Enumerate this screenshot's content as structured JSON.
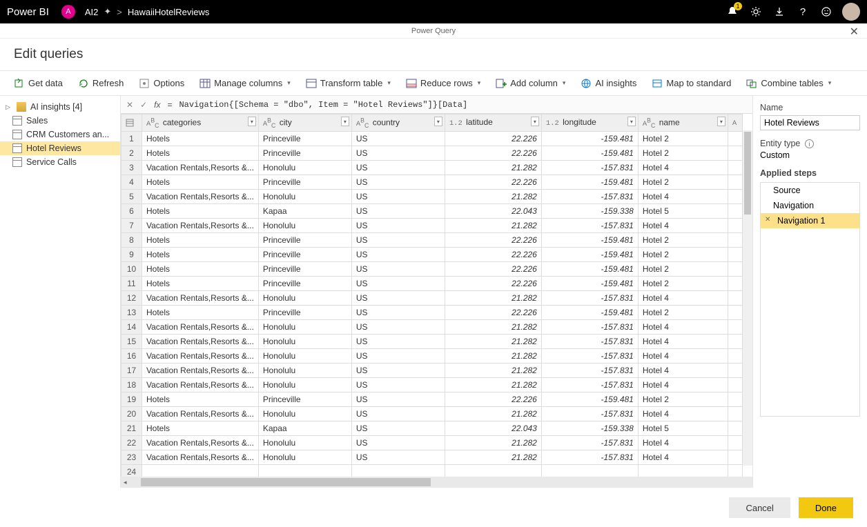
{
  "topbar": {
    "product": "Power BI",
    "pill": "A",
    "workspace": "AI2",
    "breadcrumb_sep": ">",
    "file": "HawaiiHotelReviews",
    "notification_badge": "1"
  },
  "pq": {
    "title": "Power Query",
    "heading": "Edit queries"
  },
  "ribbon": {
    "get_data": "Get data",
    "refresh": "Refresh",
    "options": "Options",
    "manage_columns": "Manage columns",
    "transform_table": "Transform table",
    "reduce_rows": "Reduce rows",
    "add_column": "Add column",
    "ai_insights": "AI insights",
    "map_to_standard": "Map to standard",
    "combine_tables": "Combine tables"
  },
  "nav": {
    "group_label": "AI insights [4]",
    "items": [
      "Sales",
      "CRM Customers an...",
      "Hotel Reviews",
      "Service Calls"
    ],
    "selected": "Hotel Reviews"
  },
  "formula": {
    "fx": "fx",
    "eq": "=",
    "expression": "Navigation{[Schema = \"dbo\", Item = \"Hotel Reviews\"]}[Data]"
  },
  "grid": {
    "columns": [
      {
        "type": "ABC",
        "name": "categories"
      },
      {
        "type": "ABC",
        "name": "city"
      },
      {
        "type": "ABC",
        "name": "country"
      },
      {
        "type": "1.2",
        "name": "latitude"
      },
      {
        "type": "1.2",
        "name": "longitude"
      },
      {
        "type": "ABC",
        "name": "name"
      }
    ],
    "rows": [
      {
        "n": 1,
        "categories": "Hotels",
        "city": "Princeville",
        "country": "US",
        "latitude": "22.226",
        "longitude": "-159.481",
        "name": "Hotel 2"
      },
      {
        "n": 2,
        "categories": "Hotels",
        "city": "Princeville",
        "country": "US",
        "latitude": "22.226",
        "longitude": "-159.481",
        "name": "Hotel 2"
      },
      {
        "n": 3,
        "categories": "Vacation Rentals,Resorts &...",
        "city": "Honolulu",
        "country": "US",
        "latitude": "21.282",
        "longitude": "-157.831",
        "name": "Hotel 4"
      },
      {
        "n": 4,
        "categories": "Hotels",
        "city": "Princeville",
        "country": "US",
        "latitude": "22.226",
        "longitude": "-159.481",
        "name": "Hotel 2"
      },
      {
        "n": 5,
        "categories": "Vacation Rentals,Resorts &...",
        "city": "Honolulu",
        "country": "US",
        "latitude": "21.282",
        "longitude": "-157.831",
        "name": "Hotel 4"
      },
      {
        "n": 6,
        "categories": "Hotels",
        "city": "Kapaa",
        "country": "US",
        "latitude": "22.043",
        "longitude": "-159.338",
        "name": "Hotel 5"
      },
      {
        "n": 7,
        "categories": "Vacation Rentals,Resorts &...",
        "city": "Honolulu",
        "country": "US",
        "latitude": "21.282",
        "longitude": "-157.831",
        "name": "Hotel 4"
      },
      {
        "n": 8,
        "categories": "Hotels",
        "city": "Princeville",
        "country": "US",
        "latitude": "22.226",
        "longitude": "-159.481",
        "name": "Hotel 2"
      },
      {
        "n": 9,
        "categories": "Hotels",
        "city": "Princeville",
        "country": "US",
        "latitude": "22.226",
        "longitude": "-159.481",
        "name": "Hotel 2"
      },
      {
        "n": 10,
        "categories": "Hotels",
        "city": "Princeville",
        "country": "US",
        "latitude": "22.226",
        "longitude": "-159.481",
        "name": "Hotel 2"
      },
      {
        "n": 11,
        "categories": "Hotels",
        "city": "Princeville",
        "country": "US",
        "latitude": "22.226",
        "longitude": "-159.481",
        "name": "Hotel 2"
      },
      {
        "n": 12,
        "categories": "Vacation Rentals,Resorts &...",
        "city": "Honolulu",
        "country": "US",
        "latitude": "21.282",
        "longitude": "-157.831",
        "name": "Hotel 4"
      },
      {
        "n": 13,
        "categories": "Hotels",
        "city": "Princeville",
        "country": "US",
        "latitude": "22.226",
        "longitude": "-159.481",
        "name": "Hotel 2"
      },
      {
        "n": 14,
        "categories": "Vacation Rentals,Resorts &...",
        "city": "Honolulu",
        "country": "US",
        "latitude": "21.282",
        "longitude": "-157.831",
        "name": "Hotel 4"
      },
      {
        "n": 15,
        "categories": "Vacation Rentals,Resorts &...",
        "city": "Honolulu",
        "country": "US",
        "latitude": "21.282",
        "longitude": "-157.831",
        "name": "Hotel 4"
      },
      {
        "n": 16,
        "categories": "Vacation Rentals,Resorts &...",
        "city": "Honolulu",
        "country": "US",
        "latitude": "21.282",
        "longitude": "-157.831",
        "name": "Hotel 4"
      },
      {
        "n": 17,
        "categories": "Vacation Rentals,Resorts &...",
        "city": "Honolulu",
        "country": "US",
        "latitude": "21.282",
        "longitude": "-157.831",
        "name": "Hotel 4"
      },
      {
        "n": 18,
        "categories": "Vacation Rentals,Resorts &...",
        "city": "Honolulu",
        "country": "US",
        "latitude": "21.282",
        "longitude": "-157.831",
        "name": "Hotel 4"
      },
      {
        "n": 19,
        "categories": "Hotels",
        "city": "Princeville",
        "country": "US",
        "latitude": "22.226",
        "longitude": "-159.481",
        "name": "Hotel 2"
      },
      {
        "n": 20,
        "categories": "Vacation Rentals,Resorts &...",
        "city": "Honolulu",
        "country": "US",
        "latitude": "21.282",
        "longitude": "-157.831",
        "name": "Hotel 4"
      },
      {
        "n": 21,
        "categories": "Hotels",
        "city": "Kapaa",
        "country": "US",
        "latitude": "22.043",
        "longitude": "-159.338",
        "name": "Hotel 5"
      },
      {
        "n": 22,
        "categories": "Vacation Rentals,Resorts &...",
        "city": "Honolulu",
        "country": "US",
        "latitude": "21.282",
        "longitude": "-157.831",
        "name": "Hotel 4"
      },
      {
        "n": 23,
        "categories": "Vacation Rentals,Resorts &...",
        "city": "Honolulu",
        "country": "US",
        "latitude": "21.282",
        "longitude": "-157.831",
        "name": "Hotel 4"
      },
      {
        "n": 24,
        "categories": "",
        "city": "",
        "country": "",
        "latitude": "",
        "longitude": "",
        "name": ""
      }
    ]
  },
  "right": {
    "name_label": "Name",
    "name_value": "Hotel Reviews",
    "entity_label": "Entity type",
    "entity_value": "Custom",
    "steps_label": "Applied steps",
    "steps": [
      "Source",
      "Navigation",
      "Navigation 1"
    ],
    "selected_step": "Navigation 1"
  },
  "footer": {
    "cancel": "Cancel",
    "done": "Done"
  }
}
